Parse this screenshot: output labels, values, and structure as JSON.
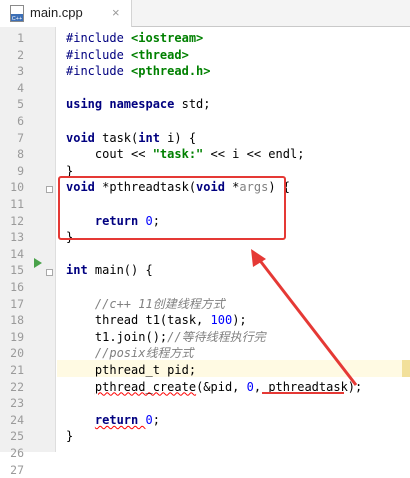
{
  "tab": {
    "title": "main.cpp",
    "close_symbol": "×",
    "icon": "cpp-file-icon",
    "icon_label": "C++"
  },
  "line_numbers": [
    "1",
    "2",
    "3",
    "4",
    "5",
    "6",
    "7",
    "8",
    "9",
    "10",
    "11",
    "12",
    "13",
    "14",
    "15",
    "16",
    "17",
    "18",
    "19",
    "20",
    "21",
    "22",
    "23",
    "24",
    "25",
    "26",
    "27"
  ],
  "code": {
    "l1": [
      "#include ",
      "<iostream>"
    ],
    "l2": [
      "#include ",
      "<thread>"
    ],
    "l3": [
      "#include ",
      "<pthread.h>"
    ],
    "l5": [
      "using namespace ",
      "std;"
    ],
    "l7": [
      "void ",
      "task(",
      "int ",
      "i) {"
    ],
    "l8": [
      "    cout << ",
      "\"task:\"",
      " << i << endl;"
    ],
    "l9": [
      "}"
    ],
    "l11": [
      "void ",
      "*pthreadtask(",
      "void ",
      "*",
      "args",
      ") {"
    ],
    "l13": [
      "    ",
      "return ",
      "0",
      ";"
    ],
    "l14": [
      "}"
    ],
    "l16": [
      "int ",
      "main() {"
    ],
    "l18": [
      "    ",
      "//c++ 11创建线程方式"
    ],
    "l19": [
      "    thread t1(task, ",
      "100",
      ");"
    ],
    "l20": [
      "    t1.join();",
      "//等待线程执行完"
    ],
    "l22": [
      "    ",
      "//posix线程方式"
    ],
    "l23": [
      "    pthread_t pid;"
    ],
    "l24": [
      "    ",
      "pthread_create",
      "(&pid, ",
      "0",
      ", pthreadtask);"
    ],
    "l26": [
      "    ",
      "return ",
      "0",
      ";"
    ],
    "l27": [
      "}"
    ]
  },
  "colors": {
    "keyword": "#000080",
    "string": "#008000",
    "number": "#0000ff",
    "comment": "#808080",
    "annotation": "#e53935"
  }
}
